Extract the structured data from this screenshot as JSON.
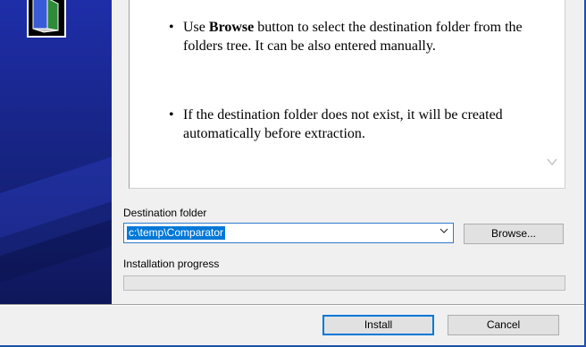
{
  "info": {
    "bullet1_prefix": "Use ",
    "bullet1_bold": "Browse",
    "bullet1_rest": " button to select the destination folder from the folders tree. It can be also entered manually.",
    "bullet2": "If the destination folder does not exist, it will be created automatically before extraction."
  },
  "destination": {
    "label": "Destination folder",
    "value": "c:\\temp\\Comparator",
    "browse_label": "Browse..."
  },
  "progress": {
    "label": "Installation progress",
    "value": 0
  },
  "footer": {
    "install_label": "Install",
    "cancel_label": "Cancel"
  },
  "icons": {
    "logo": "installer-logo-icon",
    "dropdown": "chevron-down-icon",
    "scroll": "scroll-down-icon"
  },
  "colors": {
    "sidepanel": "#1e2ea8",
    "selection": "#0078d7",
    "frame": "#1f4ea8"
  }
}
